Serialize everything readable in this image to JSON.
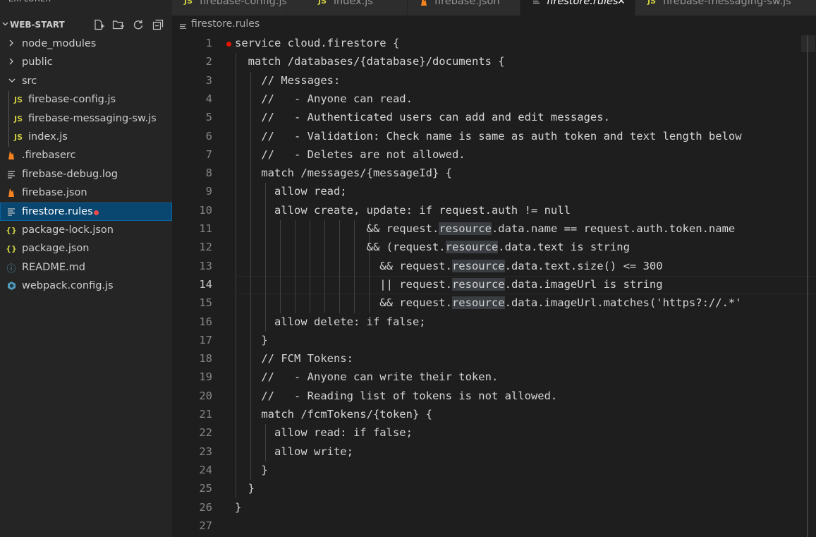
{
  "explorer": {
    "title": "EXPLORER",
    "more": "···",
    "project": "WEB-START",
    "actions": [
      "new-file-icon",
      "new-folder-icon",
      "refresh-icon",
      "collapse-all-icon"
    ],
    "items": [
      {
        "label": "node_modules",
        "kind": "folder",
        "expanded": false,
        "depth": 0
      },
      {
        "label": "public",
        "kind": "folder",
        "expanded": false,
        "depth": 0
      },
      {
        "label": "src",
        "kind": "folder",
        "expanded": true,
        "depth": 0
      },
      {
        "label": "firebase-config.js",
        "kind": "js",
        "icon_text": "JS",
        "depth": 1
      },
      {
        "label": "firebase-messaging-sw.js",
        "kind": "js",
        "icon_text": "JS",
        "depth": 1
      },
      {
        "label": "index.js",
        "kind": "js",
        "icon_text": "JS",
        "depth": 1
      },
      {
        "label": ".firebaserc",
        "kind": "firebase",
        "depth": 0
      },
      {
        "label": "firebase-debug.log",
        "kind": "text",
        "depth": 0
      },
      {
        "label": "firebase.json",
        "kind": "firebase",
        "depth": 0
      },
      {
        "label": "firestore.rules",
        "kind": "text",
        "depth": 0,
        "selected": true,
        "modified": true
      },
      {
        "label": "package-lock.json",
        "kind": "json",
        "icon_text": "{}",
        "depth": 0
      },
      {
        "label": "package.json",
        "kind": "json",
        "icon_text": "{}",
        "depth": 0
      },
      {
        "label": "README.md",
        "kind": "info",
        "icon_text": "ⓘ",
        "depth": 0
      },
      {
        "label": "webpack.config.js",
        "kind": "webpack",
        "depth": 0
      }
    ]
  },
  "tabs": [
    {
      "label": "firebase-config.js",
      "kind": "js",
      "icon_text": "JS"
    },
    {
      "label": "index.js",
      "kind": "js",
      "icon_text": "JS"
    },
    {
      "label": "firebase.json",
      "kind": "firebase"
    },
    {
      "label": "firestore.rules",
      "kind": "text",
      "active": true,
      "close": "✕"
    },
    {
      "label": "firebase-messaging-sw.js",
      "kind": "js",
      "icon_text": "JS"
    }
  ],
  "breadcrumb": "firestore.rules",
  "editor": {
    "current_line": 14,
    "breakpoint_line": 1,
    "lines": [
      {
        "n": "1",
        "text": "service cloud.firestore {"
      },
      {
        "n": "2",
        "text": "  match /databases/{database}/documents {"
      },
      {
        "n": "3",
        "text": "    // Messages:"
      },
      {
        "n": "4",
        "text": "    //   - Anyone can read."
      },
      {
        "n": "5",
        "text": "    //   - Authenticated users can add and edit messages."
      },
      {
        "n": "6",
        "text": "    //   - Validation: Check name is same as auth token and text length below"
      },
      {
        "n": "7",
        "text": "    //   - Deletes are not allowed."
      },
      {
        "n": "8",
        "text": "    match /messages/{messageId} {"
      },
      {
        "n": "9",
        "text": "      allow read;"
      },
      {
        "n": "10",
        "text": "      allow create, update: if request.auth != null"
      },
      {
        "n": "11",
        "text": "                    && request.resource.data.name == request.auth.token.name"
      },
      {
        "n": "12",
        "text": "                    && (request.resource.data.text is string"
      },
      {
        "n": "13",
        "text": "                      && request.resource.data.text.size() <= 300"
      },
      {
        "n": "14",
        "text": "                      || request.resource.data.imageUrl is string"
      },
      {
        "n": "15",
        "text": "                      && request.resource.data.imageUrl.matches('https?://.*'"
      },
      {
        "n": "16",
        "text": "      allow delete: if false;"
      },
      {
        "n": "17",
        "text": "    }"
      },
      {
        "n": "18",
        "text": "    // FCM Tokens:"
      },
      {
        "n": "19",
        "text": "    //   - Anyone can write their token."
      },
      {
        "n": "20",
        "text": "    //   - Reading list of tokens is not allowed."
      },
      {
        "n": "21",
        "text": "    match /fcmTokens/{token} {"
      },
      {
        "n": "22",
        "text": "      allow read: if false;"
      },
      {
        "n": "23",
        "text": "      allow write;"
      },
      {
        "n": "24",
        "text": "    }"
      },
      {
        "n": "25",
        "text": "  }"
      },
      {
        "n": "26",
        "text": "}"
      },
      {
        "n": "27",
        "text": ""
      }
    ]
  },
  "colors": {
    "sidebar_bg": "#252526",
    "editor_bg": "#1e1e1e",
    "selection": "#094771",
    "js_icon": "#cbcb41",
    "json_icon": "#cbcb41",
    "firebase_icon": "#f5831f",
    "info_icon": "#519aba",
    "webpack_icon": "#519aba",
    "modified_dot": "#f14c4c",
    "breakpoint": "#e51400"
  }
}
